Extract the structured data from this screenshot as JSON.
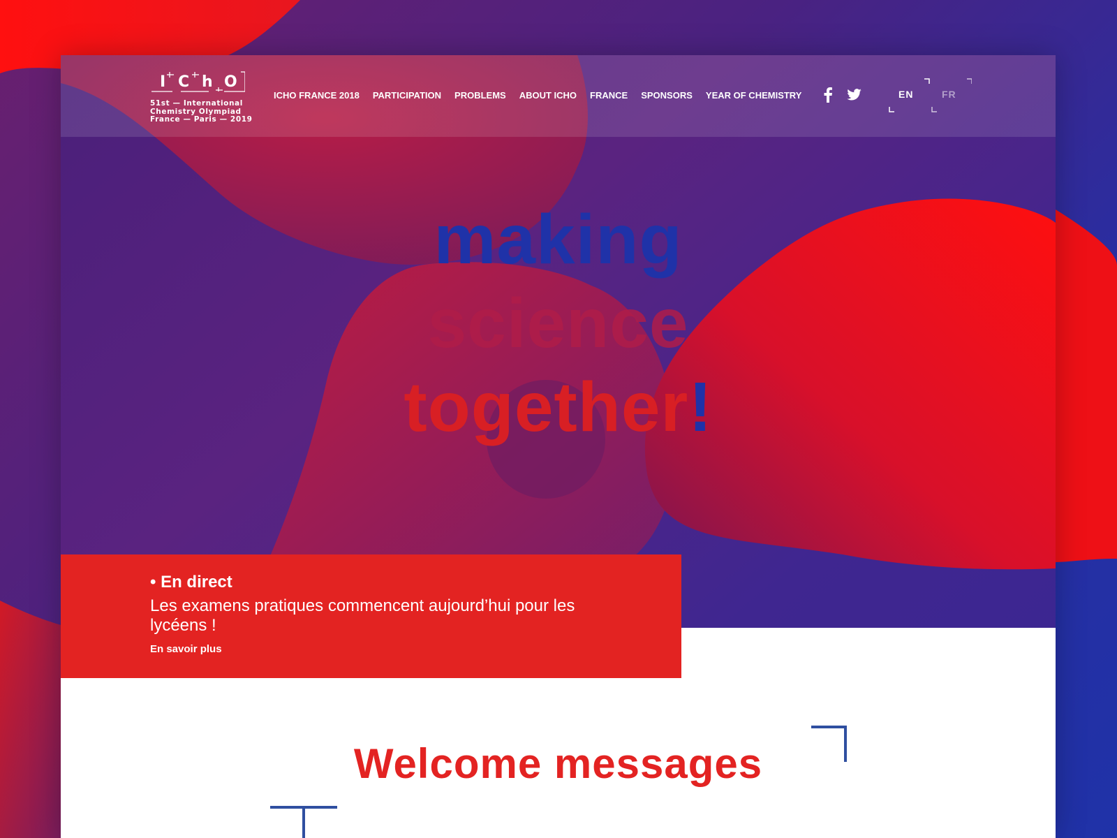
{
  "colors": {
    "accent_red": "#e32322",
    "deep_blue": "#1f32a8",
    "purple": "#5a2380",
    "white": "#ffffff"
  },
  "logo": {
    "letters": [
      "I",
      "C",
      "h",
      "O"
    ],
    "lines": [
      "51st — International",
      "Chemistry Olympiad",
      "France — Paris — 2019"
    ]
  },
  "nav": {
    "items": [
      {
        "label": "ICHO FRANCE 2018"
      },
      {
        "label": "PARTICIPATION"
      },
      {
        "label": "PROBLEMS"
      },
      {
        "label": "ABOUT ICHO"
      },
      {
        "label": "FRANCE"
      },
      {
        "label": "SPONSORS"
      },
      {
        "label": "YEAR OF CHEMISTRY"
      }
    ]
  },
  "social": {
    "facebook_icon": "facebook-icon",
    "twitter_icon": "twitter-icon"
  },
  "language": {
    "options": [
      "EN",
      "FR"
    ],
    "selected": "EN"
  },
  "hero": {
    "line1": "making",
    "line2": "science",
    "line3": "together",
    "line3_suffix": "!"
  },
  "news": {
    "title": "• En direct",
    "body": "Les examens pratiques commencent aujourd’hui pour les lycéens !",
    "link": "En savoir plus"
  },
  "welcome": {
    "title": "Welcome messages"
  }
}
